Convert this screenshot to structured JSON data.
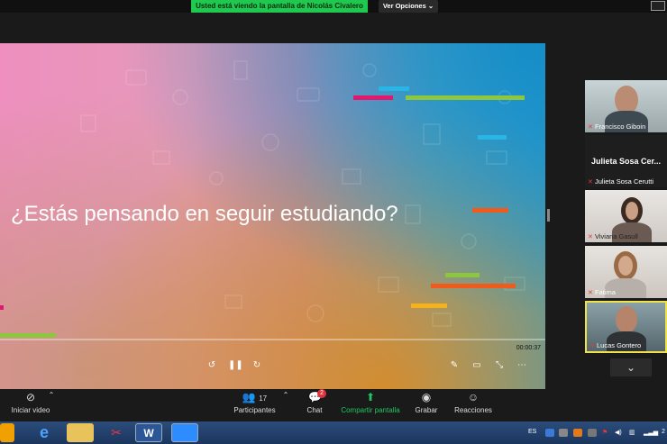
{
  "banner": {
    "sharing_text": "Usted está viendo la pantalla de Nicolás Civalero",
    "view_options": "Ver Opciones"
  },
  "slide": {
    "title": "¿Estás pensando en seguir estudiando?",
    "elapsed": "00:00:37",
    "colors": {
      "magenta": "#e0196e",
      "lime": "#8dc63f",
      "cyan": "#29b6e6",
      "orange": "#f05a1a",
      "yellow": "#f5b21b"
    }
  },
  "participants_panel": {
    "tiles": [
      {
        "name": "Francisco Giboin",
        "muted": true
      },
      {
        "name": "Julieta Sosa Cerutti",
        "display": "Julieta Sosa Cer...",
        "muted": true
      },
      {
        "name": "Viviana Gasull",
        "muted": true
      },
      {
        "name": "Fatima",
        "muted": true
      },
      {
        "name": "Lucas Gontero",
        "muted": true,
        "active_speaker": true
      }
    ]
  },
  "toolbar": {
    "video": "Iniciar video",
    "participants": "Participantes",
    "participants_count": "17",
    "chat": "Chat",
    "chat_badge": "2",
    "share": "Compartir pantalla",
    "record": "Grabar",
    "reactions": "Reacciones"
  },
  "taskbar": {
    "lang": "ES",
    "clock_partial": "2"
  }
}
